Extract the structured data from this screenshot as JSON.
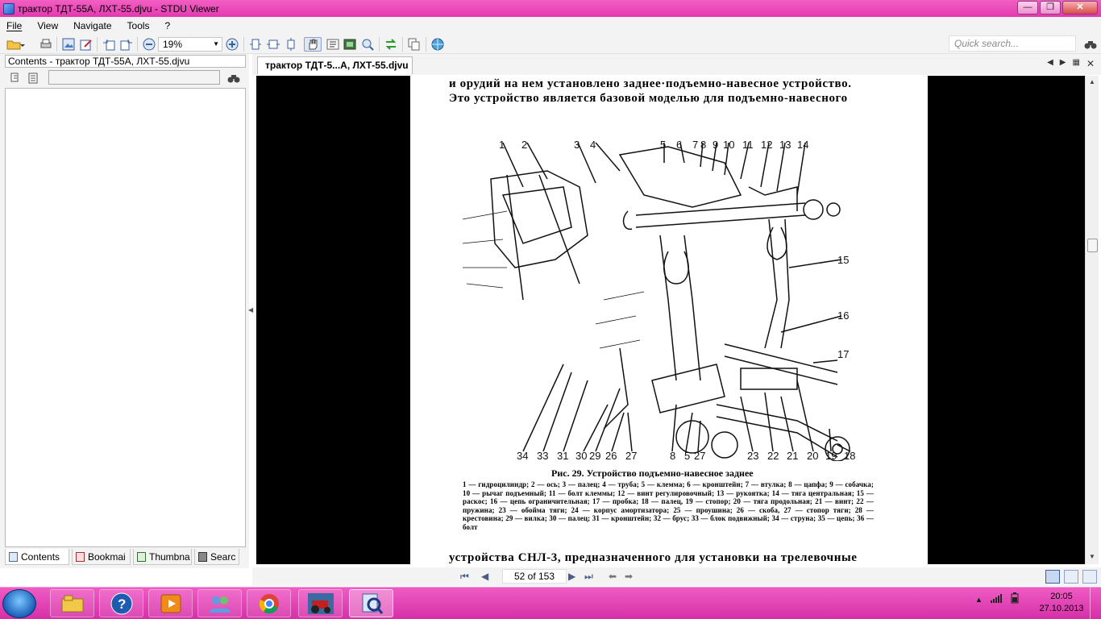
{
  "window": {
    "title": "трактор ТДТ-55А, ЛХТ-55.djvu - STDU Viewer",
    "controls": {
      "minimize": "—",
      "maximize": "❐",
      "close": "✕"
    }
  },
  "menu": [
    "File",
    "View",
    "Navigate",
    "Tools",
    "?"
  ],
  "toolbar": {
    "zoom_value": "19%",
    "quick_search_placeholder": "Quick search..."
  },
  "left_panel": {
    "title": "Contents - трактор ТДТ-55А, ЛХТ-55.djvu",
    "tabs": [
      {
        "label": "Contents",
        "icon": "contents-icon"
      },
      {
        "label": "Bookmai",
        "icon": "bookmark-icon"
      },
      {
        "label": "Thumbna",
        "icon": "thumbnails-icon"
      },
      {
        "label": "Searc",
        "icon": "search-icon"
      }
    ]
  },
  "document": {
    "tab_label": "трактор ТДТ-5...А, ЛХТ-55.djvu",
    "text_top_line1": "и орудий на нем установлено заднее·подъемно-навесное устройство.",
    "text_top_line2": "Это устройство является базовой моделью для подъемно-навесного",
    "figure_top_numbers": [
      "1",
      "2",
      "3",
      "4",
      "5",
      "6",
      "7",
      "8",
      "9",
      "10",
      "11",
      "12",
      "13",
      "14"
    ],
    "figure_side_numbers": [
      "15",
      "16",
      "17"
    ],
    "figure_bottom_numbers": [
      "34",
      "33",
      "31",
      "30",
      "29",
      "26",
      "27",
      "8",
      "5",
      "27",
      "23",
      "22",
      "21",
      "20",
      "19",
      "18"
    ],
    "caption": "Рис. 29. Устройство подъемно-навесное заднее",
    "legend": "1 — гидроцилиндр; 2 — ось; 3 — палец; 4 — труба; 5 — клемма; 6 — кронштейн; 7 — втулка; 8 — цапфа; 9 — собачка; 10 — рычаг подъемный; 11 — болт клеммы; 12 — винт регулировочный; 13 — рукоятка; 14 — тяга центральная; 15 — раскос; 16 — цепь ограничительная; 17 — пробка; 18 — палец, 19 — стопор; 20 — тяга продольная; 21 — винт; 22 — пружина; 23 — обойма тяги; 24 — корпус амортизатора; 25 — проушина; 26 — скоба, 27 — стопор тяги; 28 — крестовина; 29 — вилка; 30 — палец; 31 — кронштейн; 32 — брус; 33 — блок подвижный; 34 — струна; 35 — цепь; 36 — болт",
    "text_bottom": "устройства СНЛ-3, предназначенного для установки на трелевочные"
  },
  "navigation": {
    "page_indicator": "52 of 153"
  },
  "taskbar": {
    "clock_time": "20:05",
    "clock_date": "27.10.2013"
  }
}
